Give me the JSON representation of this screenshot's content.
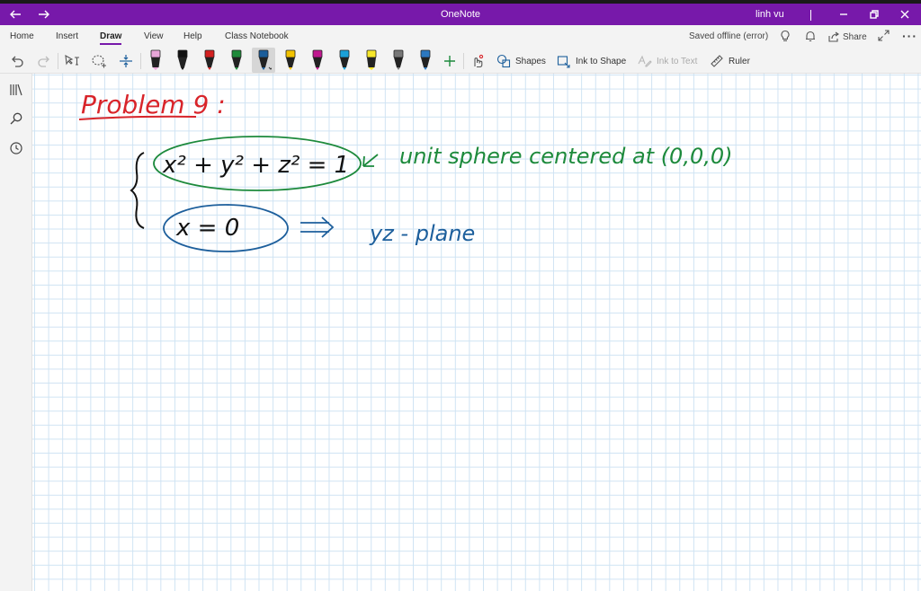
{
  "window": {
    "app_title": "OneNote",
    "user": "linh vu"
  },
  "menu": {
    "tabs": [
      "Home",
      "Insert",
      "Draw",
      "View",
      "Help",
      "Class Notebook"
    ],
    "active_tab": "Draw",
    "status": "Saved offline (error)",
    "share_label": "Share"
  },
  "ribbon": {
    "shapes_label": "Shapes",
    "ink_to_shape_label": "Ink to Shape",
    "ink_to_text_label": "Ink to Text",
    "ruler_label": "Ruler",
    "pens": [
      {
        "name": "pen-pink-highlighter",
        "color": "#e8a6d8"
      },
      {
        "name": "pen-black",
        "color": "#111111"
      },
      {
        "name": "pen-red",
        "color": "#d32020"
      },
      {
        "name": "pen-green",
        "color": "#1f8a3a"
      },
      {
        "name": "pen-blue-selected",
        "color": "#1a5d9a"
      },
      {
        "name": "pen-yellow",
        "color": "#f2c200"
      },
      {
        "name": "pen-magenta",
        "color": "#c0188f"
      },
      {
        "name": "pen-cyan",
        "color": "#1aa0d8"
      },
      {
        "name": "highlighter-yellow",
        "color": "#f6e629"
      },
      {
        "name": "pen-gray",
        "color": "#777777"
      },
      {
        "name": "pen-dark-blue",
        "color": "#2c78c0"
      }
    ]
  },
  "ink": {
    "heading": "Problem 9 :",
    "equation_1": "x² + y² + z² = 1",
    "note_1": "unit sphere centered at (0,0,0)",
    "equation_2": "x = 0",
    "note_2": "yz - plane",
    "colors": {
      "red": "#d8242a",
      "green": "#1d8a3c",
      "blue": "#1d5f9c",
      "black": "#111111"
    }
  }
}
